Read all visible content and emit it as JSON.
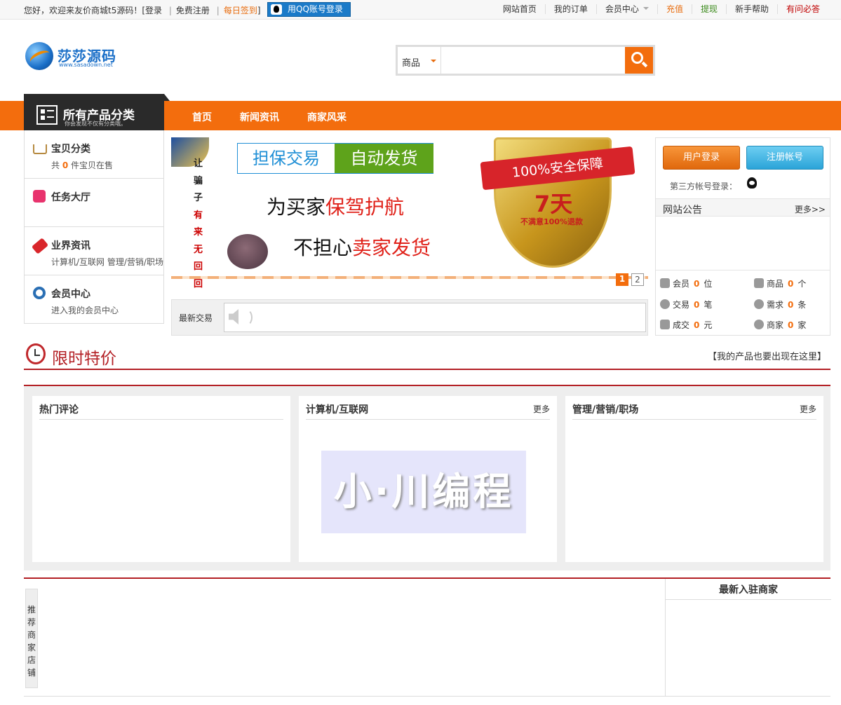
{
  "topbar": {
    "greeting": "您好，欢迎来友价商城t5源码！[",
    "login": "登录",
    "sep1": "|",
    "register": "免费注册",
    "sep2": "|",
    "checkin": "每日签到",
    "close": "]",
    "qq_login": "用QQ账号登录",
    "links": [
      "网站首页",
      "我的订单",
      "会员中心",
      "充值",
      "提现",
      "新手帮助",
      "有问必答"
    ],
    "link_colors": [
      "#333333",
      "#333333",
      "#333333",
      "#e86d0f",
      "#3a8a1a",
      "#333333",
      "#c00000"
    ]
  },
  "logo": {
    "name": "莎莎源码",
    "url": "www.sasadown.net"
  },
  "search": {
    "category": "商品",
    "placeholder": ""
  },
  "nav": {
    "all_categories": "所有产品分类",
    "all_categories_sub": "你会发现不仅有分类哦。",
    "links": [
      "首页",
      "新闻资讯",
      "商家风采"
    ]
  },
  "sidebar": [
    {
      "title": "宝贝分类",
      "desc_pre": "共",
      "count": "0",
      "desc_post": "件宝贝在售",
      "icon": "cart-icon"
    },
    {
      "title": "任务大厅",
      "desc_pre": "",
      "count": "",
      "desc_post": "",
      "icon": "bag-icon"
    },
    {
      "title": "业界资讯",
      "desc_pre": "计算机/互联网 管理/营销/职场",
      "count": "",
      "desc_post": "",
      "icon": "tag-icon"
    },
    {
      "title": "会员中心",
      "desc_pre": "进入我的会员中心",
      "count": "",
      "desc_post": "",
      "icon": "gear-icon"
    }
  ],
  "banner": {
    "vertical_black": "让骗子",
    "vertical_red": "有来无回回",
    "deal_a": "担保交易",
    "deal_b": "自动发货",
    "slogan1_a": "为买家",
    "slogan1_b": "保驾护航",
    "slogan2_a": "不担心",
    "slogan2_b": "卖家发货",
    "ribbon": "100%安全保障",
    "days": "7天",
    "refund": "不满意100%退款",
    "pages": [
      "1",
      "2"
    ],
    "active_page": "1"
  },
  "latest": {
    "label": "最新交易"
  },
  "rpanel": {
    "login_btn": "用户登录",
    "register_btn": "注册帐号",
    "third_login": "第三方帐号登录：",
    "notice_title": "网站公告",
    "notice_more": "更多>>",
    "stats": [
      {
        "label": "会员",
        "value": "0",
        "unit": "位",
        "icon": "user-icon"
      },
      {
        "label": "商品",
        "value": "0",
        "unit": "个",
        "icon": "download-icon"
      },
      {
        "label": "交易",
        "value": "0",
        "unit": "笔",
        "icon": "link-icon"
      },
      {
        "label": "需求",
        "value": "0",
        "unit": "条",
        "icon": "search-icon"
      },
      {
        "label": "成交",
        "value": "0",
        "unit": "元",
        "icon": "bar-chart-icon"
      },
      {
        "label": "商家",
        "value": "0",
        "unit": "家",
        "icon": "globe-icon"
      }
    ]
  },
  "sale": {
    "title": "限时特价",
    "promo": "【我的产品也要出现在这里】"
  },
  "panels": [
    {
      "title": "热门评论",
      "more": ""
    },
    {
      "title": "计算机/互联网",
      "more": "更多"
    },
    {
      "title": "管理/营销/职场",
      "more": "更多"
    }
  ],
  "watermark": "小·川编程",
  "bottom": {
    "recommend": "推荐商家店铺",
    "merchants_title": "最新入驻商家"
  }
}
